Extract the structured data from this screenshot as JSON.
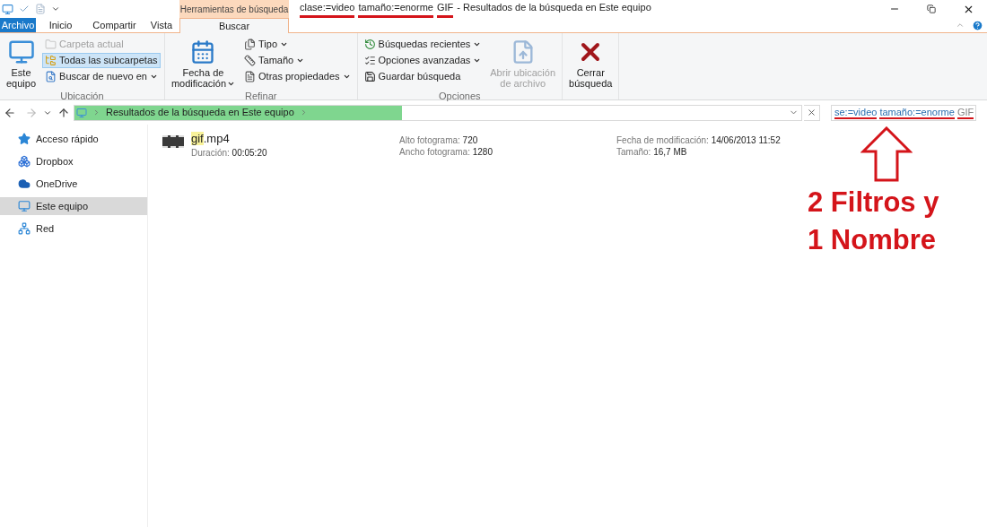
{
  "context_tab": {
    "label": "Herramientas de búsqueda"
  },
  "window": {
    "title_parts": [
      {
        "text": "clase:=video",
        "marked": true
      },
      {
        "text": "tamaño:=enorme",
        "marked": true
      },
      {
        "text": "GIF",
        "marked": true
      },
      {
        "text": "- Resultados de la búsqueda en Este equipo",
        "marked": false
      }
    ]
  },
  "tabs": [
    {
      "label": "Archivo",
      "kind": "file",
      "selected": false
    },
    {
      "label": "Inicio",
      "kind": "normal",
      "selected": false
    },
    {
      "label": "Compartir",
      "kind": "normal",
      "selected": false
    },
    {
      "label": "Vista",
      "kind": "normal",
      "selected": false
    },
    {
      "label": "Buscar",
      "kind": "normal",
      "selected": true
    }
  ],
  "ribbon": {
    "groups": [
      {
        "label": "Ubicación",
        "items": [
          {
            "kind": "large",
            "lines": [
              "Este",
              "equipo"
            ],
            "dropdown": false,
            "disabled": false
          },
          {
            "kind": "small",
            "label": "Carpeta actual",
            "dropdown": false,
            "disabled": true,
            "selected": false
          },
          {
            "kind": "small",
            "label": "Todas las subcarpetas",
            "dropdown": false,
            "disabled": false,
            "selected": true
          },
          {
            "kind": "small",
            "label": "Buscar de nuevo en",
            "dropdown": true,
            "disabled": false,
            "selected": false
          }
        ]
      },
      {
        "label": "Refinar",
        "items": [
          {
            "kind": "large",
            "lines": [
              "Fecha de",
              "modificación"
            ],
            "dropdown": true,
            "disabled": false
          },
          {
            "kind": "small",
            "label": "Tipo",
            "dropdown": true,
            "disabled": false,
            "selected": false
          },
          {
            "kind": "small",
            "label": "Tamaño",
            "dropdown": true,
            "disabled": false,
            "selected": false
          },
          {
            "kind": "small",
            "label": "Otras propiedades",
            "dropdown": true,
            "disabled": false,
            "selected": false
          }
        ]
      },
      {
        "label": "Opciones",
        "items": [
          {
            "kind": "small",
            "label": "Búsquedas recientes",
            "dropdown": true,
            "disabled": false,
            "selected": false
          },
          {
            "kind": "small",
            "label": "Opciones avanzadas",
            "dropdown": true,
            "disabled": false,
            "selected": false
          },
          {
            "kind": "small",
            "label": "Guardar búsqueda",
            "dropdown": false,
            "disabled": false,
            "selected": false
          },
          {
            "kind": "large",
            "lines": [
              "Abrir ubicación",
              "de archivo"
            ],
            "dropdown": false,
            "disabled": true
          }
        ]
      },
      {
        "items": [
          {
            "kind": "large",
            "lines": [
              "Cerrar",
              "búsqueda"
            ],
            "dropdown": false,
            "disabled": false
          }
        ]
      }
    ]
  },
  "address_bar": {
    "path": "Resultados de la búsqueda en Este equipo",
    "level": 0.45
  },
  "search": {
    "tokens": [
      {
        "text": "se:=video",
        "kind": "filter",
        "marked": true
      },
      {
        "text": "tamaño:=enorme",
        "kind": "filter",
        "marked": true
      },
      {
        "text": "GIF",
        "kind": "name",
        "marked": true
      }
    ]
  },
  "sidebar": {
    "items": [
      {
        "label": "Acceso rápido",
        "selected": false
      },
      {
        "label": "Dropbox",
        "selected": false
      },
      {
        "label": "OneDrive",
        "selected": false
      },
      {
        "label": "Este equipo",
        "selected": true
      },
      {
        "label": "Red",
        "selected": false
      }
    ]
  },
  "results": [
    {
      "name_match": "gif",
      "name_rest": ".mp4",
      "columns": [
        [
          {
            "label": "Duración:",
            "value": "00:05:20"
          }
        ],
        [
          {
            "label": "Alto fotograma:",
            "value": "720"
          },
          {
            "label": "Ancho fotograma:",
            "value": "1280"
          }
        ],
        [
          {
            "label": "Fecha de modificación:",
            "value": "14/06/2013 11:52"
          },
          {
            "label": "Tamaño:",
            "value": "16,7 MB"
          }
        ]
      ]
    }
  ],
  "annotation": {
    "lines": [
      "2 Filtros y",
      "1 Nombre"
    ]
  }
}
